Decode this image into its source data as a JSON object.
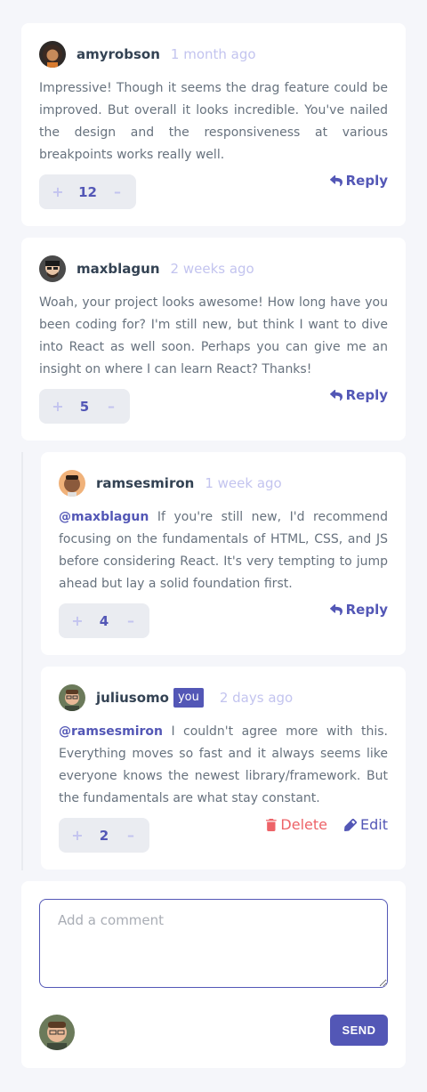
{
  "comments": [
    {
      "username": "amyrobson",
      "time": "1 month ago",
      "text": "Impressive! Though it seems the drag feature could be improved. But overall it looks incredible. You've nailed the design and the responsiveness at various breakpoints works really well.",
      "score": "12",
      "plus": "+",
      "minus": "–",
      "reply_label": "Reply"
    },
    {
      "username": "maxblagun",
      "time": "2 weeks ago",
      "text": "Woah, your project looks awesome! How long have you been coding for? I'm still new, but think I want to dive into React as well soon. Perhaps you can give me an insight on where I can learn React? Thanks!",
      "score": "5",
      "plus": "+",
      "minus": "–",
      "reply_label": "Reply"
    }
  ],
  "replies": [
    {
      "username": "ramsesmiron",
      "time": "1 week ago",
      "mention": "@maxblagun",
      "text": "If you're still new, I'd recommend focusing on the fundamentals of HTML, CSS, and JS before considering React. It's very tempting to jump ahead but lay a solid foundation first.",
      "score": "4",
      "plus": "+",
      "minus": "–",
      "reply_label": "Reply"
    },
    {
      "username": "juliusomo",
      "badge": "you",
      "time": "2 days ago",
      "mention": "@ramsesmiron",
      "text": "I couldn't agree more with this. Everything moves so fast and it always seems like everyone knows the newest library/framework. But the fundamentals are what stay constant.",
      "score": "2",
      "plus": "+",
      "minus": "–",
      "delete_label": "Delete",
      "edit_label": "Edit"
    }
  ],
  "composer": {
    "placeholder": "Add a comment",
    "send_label": "SEND"
  },
  "icons": {
    "reply": "reply-icon",
    "delete": "trash-icon",
    "edit": "pencil-icon"
  },
  "colors": {
    "primary": "#5357b6",
    "danger": "#ed6368",
    "muted": "#c3c4ef",
    "background": "#f5f6fa"
  }
}
